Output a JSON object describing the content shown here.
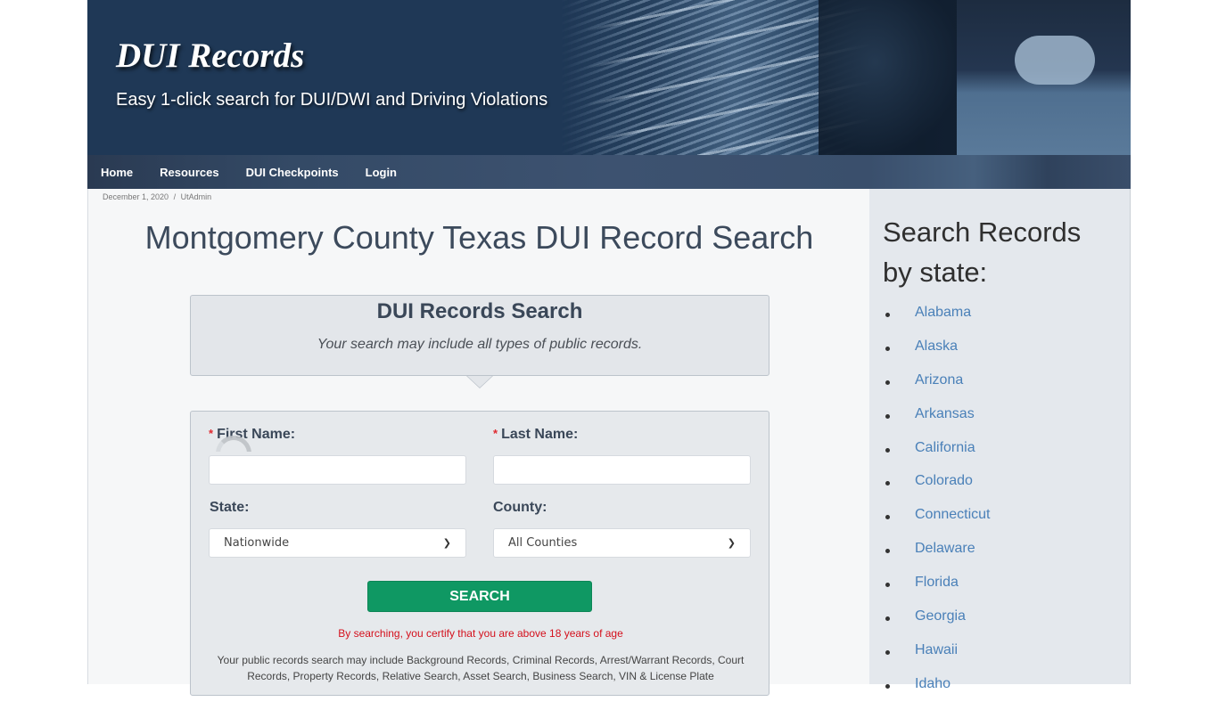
{
  "header": {
    "site_title": "DUI Records",
    "tagline": "Easy 1-click search for DUI/DWI and Driving Violations"
  },
  "nav": {
    "items": [
      {
        "label": "Home"
      },
      {
        "label": "Resources"
      },
      {
        "label": "DUI Checkpoints"
      },
      {
        "label": "Login"
      }
    ]
  },
  "post": {
    "date": "December 1, 2020",
    "separator": "/",
    "author": "UtAdmin",
    "title": "Montgomery County Texas DUI Record Search"
  },
  "intro": {
    "heading": "DUI Records Search",
    "subtitle": "Your search may include all types of public records."
  },
  "form": {
    "required_marker": "*",
    "first_name_label": "First Name:",
    "first_name_value": "",
    "last_name_label": "Last Name:",
    "last_name_value": "",
    "state_label": "State:",
    "state_selected": "Nationwide",
    "county_label": "County:",
    "county_selected": "All Counties",
    "search_button": "SEARCH",
    "age_note": "By searching, you certify that you are above 18 years of age",
    "disclaimer": "Your public records search may include Background Records, Criminal Records, Arrest/Warrant Records, Court Records, Property Records, Relative Search, Asset Search, Business Search, VIN & License Plate"
  },
  "sidebar": {
    "heading": "Search Records by state:",
    "states": [
      "Alabama",
      "Alaska",
      "Arizona",
      "Arkansas",
      "California",
      "Colorado",
      "Connecticut",
      "Delaware",
      "Florida",
      "Georgia",
      "Hawaii",
      "Idaho"
    ]
  },
  "colors": {
    "banner_bg": "#1f3856",
    "search_button": "#0f9863",
    "link": "#4a80b8",
    "warning_text": "#d4101c"
  }
}
